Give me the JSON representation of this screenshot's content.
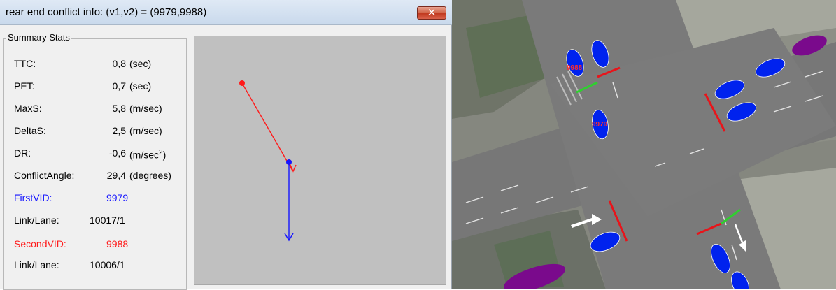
{
  "window": {
    "title": "rear end conflict info: (v1,v2) = (9979,9988)",
    "close_icon": "close-icon"
  },
  "summary": {
    "group_label": "Summary Stats",
    "rows": [
      {
        "label": "TTC:",
        "value": "0,8",
        "unit": "(sec)"
      },
      {
        "label": "PET:",
        "value": "0,7",
        "unit": "(sec)"
      },
      {
        "label": "MaxS:",
        "value": "5,8",
        "unit": "(m/sec)"
      },
      {
        "label": "DeltaS:",
        "value": "2,5",
        "unit": "(m/sec)"
      },
      {
        "label": "DR:",
        "value": "-0,6",
        "unit": "(m/sec",
        "unit_sup": "2",
        "unit_end": ")"
      },
      {
        "label": "ConflictAngle:",
        "value": "29,4",
        "unit": "(degrees)"
      }
    ],
    "first_vid": {
      "label": "FirstVID:",
      "value": "9979",
      "color": "#1515ff"
    },
    "first_link": {
      "label": "Link/Lane:",
      "value": "10017/1"
    },
    "second_vid": {
      "label": "SecondVID:",
      "value": "9988",
      "color": "#ff1a1a"
    },
    "second_link": {
      "label": "Link/Lane:",
      "value": "10006/1"
    }
  },
  "conflict_plot": {
    "background": "#c0c0c0",
    "second_vehicle_color": "#ff1a1a",
    "first_vehicle_color": "#1515ff"
  },
  "sim_view": {
    "vehicle_color": "#0022ee",
    "heavy_vehicle_color": "#7a0a8c",
    "vehicle_labels": [
      "9988",
      "9979"
    ],
    "stop_line_color": "#e8141a",
    "yield_line_color": "#2fcf2f"
  }
}
